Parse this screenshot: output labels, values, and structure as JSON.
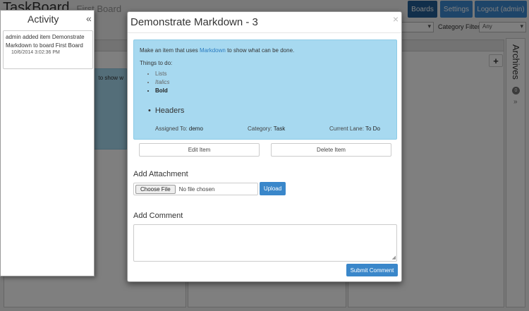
{
  "app": {
    "brand": "TaskBoard",
    "board_name": "First Board",
    "nav": {
      "boards": "Boards",
      "settings": "Settings",
      "logout": "Logout (admin)"
    },
    "category_filter_label": "Category Filter:",
    "category_filter_value": "Any",
    "background_card_text": "to show w",
    "add_symbol": "+"
  },
  "archives": {
    "title": "Archives",
    "count": "0",
    "expand_glyph": "»"
  },
  "activity": {
    "title": "Activity",
    "collapse_glyph": "«",
    "entries": [
      {
        "text": "admin added item Demonstrate Markdown to board First Board",
        "time": "10/6/2014 3:02:36 PM"
      }
    ]
  },
  "modal": {
    "title": "Demonstrate Markdown - 3",
    "close_glyph": "×",
    "description_prefix": "Make an item that uses ",
    "description_link": "Markdown",
    "description_suffix": " to show what can be done.",
    "todo_label": "Things to do:",
    "todo_items": [
      "Lists",
      "Italics",
      "Bold"
    ],
    "header_item": "Headers",
    "assigned_label": "Assigned To:",
    "assigned_value": "demo",
    "category_label": "Category:",
    "category_value": "Task",
    "lane_label": "Current Lane:",
    "lane_value": "To Do",
    "edit_button": "Edit Item",
    "delete_button": "Delete Item",
    "attachment_label": "Add Attachment",
    "choose_file": "Choose File",
    "no_file": "No file chosen",
    "upload_button": "Upload",
    "comment_label": "Add Comment",
    "comment_value": "",
    "submit_button": "Submit Comment"
  },
  "colors": {
    "primary": "#3a87ca",
    "item_background": "#a7d9f0",
    "link": "#2a7bc0"
  }
}
